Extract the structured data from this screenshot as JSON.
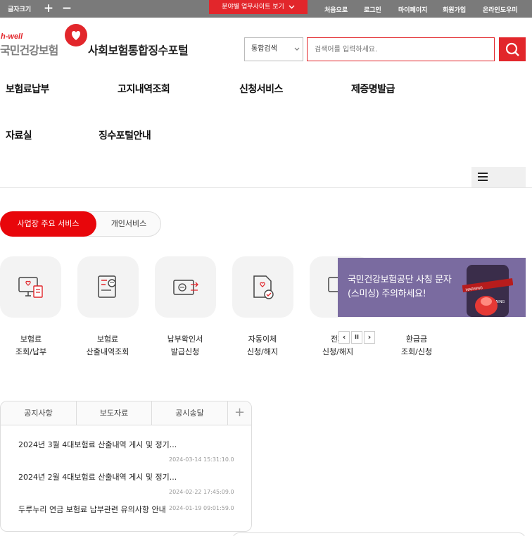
{
  "topbar": {
    "font_size_label": "글자크기",
    "font_plus": "+",
    "font_minus": "−",
    "sites_button": "분야별 업무사이트 보기 ",
    "links": [
      "처음으로",
      "로그인",
      "마이페이지",
      "회원가입",
      "온라인도우미"
    ]
  },
  "header": {
    "logo_tagline": "h-well",
    "logo_text": "국민건강보험",
    "portal_title": "사회보험통합징수포털"
  },
  "search": {
    "category": "통합검색",
    "placeholder": "검색어를 입력하세요."
  },
  "gnb": [
    "보험료납부",
    "고지내역조회",
    "신청서비스",
    "제증명발급",
    "자료실",
    "징수포털안내"
  ],
  "service_tabs": {
    "active": "사업장 주요 서비스",
    "inactive": "개인서비스"
  },
  "services": [
    {
      "line1": "보험료",
      "line2": "조회/납부",
      "icon": "monitor-document-icon"
    },
    {
      "line1": "보험료",
      "line2": "산출내역조회",
      "icon": "receipt-won-icon"
    },
    {
      "line1": "납부확인서",
      "line2": "발급신청",
      "icon": "won-card-icon"
    },
    {
      "line1": "자동이체",
      "line2": "신청/해지",
      "icon": "document-check-icon"
    },
    {
      "line1": "전자",
      "line2": "신청/해지",
      "icon": "monitor-icon"
    },
    {
      "line1": "환급금",
      "line2": "조회/신청",
      "icon": "refund-icon"
    }
  ],
  "banner": {
    "line1": "국민건강보험공단 사칭 문자",
    "line2": "(스미싱) 주의하세요!",
    "siren_label_1": "WARNING",
    "siren_label_2": "RNING",
    "prev": "‹",
    "pause": "II",
    "next": "›"
  },
  "notice": {
    "tabs": [
      "공지사항",
      "보도자료",
      "공시송달"
    ],
    "more": "+",
    "items": [
      {
        "title": "2024년 3월 4대보험료 산출내역 게시 및 정기...",
        "date": "2024-03-14 15:31:10.0"
      },
      {
        "title": "2024년 2월 4대보험료 산출내역 게시 및 정기...",
        "date": "2024-02-22 17:45:09.0"
      },
      {
        "title": "두루누리 연금 보험료 납부관련 유의사항 안내",
        "date": "2024-01-19 09:01:59.0"
      }
    ]
  },
  "colors": {
    "brand_red": "#e2262b",
    "topbar_gray": "#7a7a7a",
    "banner_purple": "#7a6ba0"
  }
}
